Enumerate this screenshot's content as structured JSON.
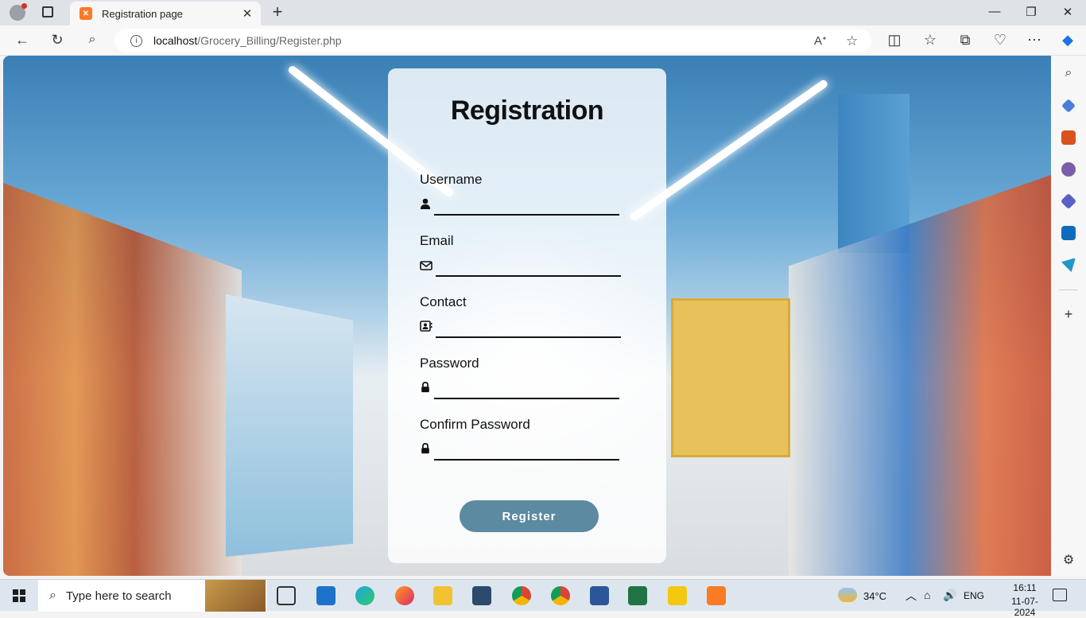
{
  "browser": {
    "tab_title": "Registration page",
    "tab_favicon": "xampp-icon",
    "url_host": "localhost",
    "url_path": "/Grocery_Billing/Register.php"
  },
  "form": {
    "title": "Registration",
    "fields": [
      {
        "label": "Username",
        "icon": "user-icon"
      },
      {
        "label": "Email",
        "icon": "envelope-icon"
      },
      {
        "label": "Contact",
        "icon": "contact-card-icon"
      },
      {
        "label": "Password",
        "icon": "lock-icon"
      },
      {
        "label": "Confirm Password",
        "icon": "lock-icon"
      }
    ],
    "submit_label": "Register",
    "button_color": "#5b8aa1"
  },
  "taskbar": {
    "search_placeholder": "Type here to search",
    "weather": "34°C",
    "language": "ENG",
    "time": "16:11",
    "date": "11-07-2024"
  }
}
